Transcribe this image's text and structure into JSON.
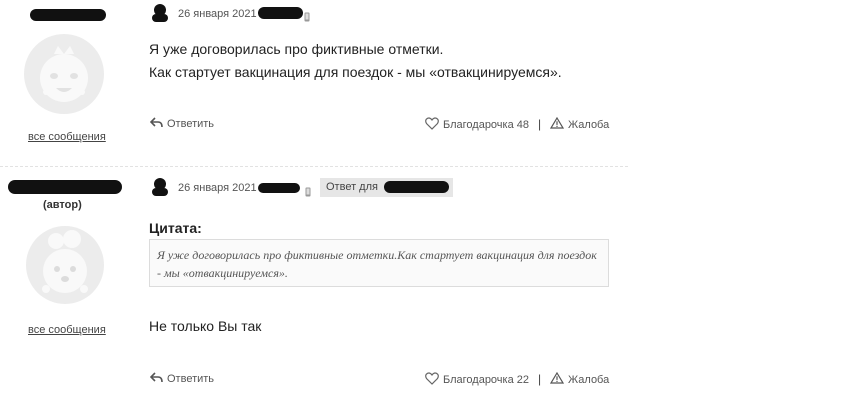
{
  "posts": [
    {
      "date": "26 января 2021",
      "message_lines": [
        "Я уже договорилась про фиктивные отметки.",
        "Как стартует вакцинация для поездок - мы «отвакцинируемся»."
      ],
      "all_messages_label": "все сообщения",
      "reply_label": "Ответить",
      "thanks_label": "Благодарочка 48",
      "separator": "|",
      "complaint_label": "Жалоба"
    },
    {
      "author_tag": "(автор)",
      "date": "26 января 2021",
      "reply_to_label": "Ответ для",
      "quote_label": "Цитата:",
      "quote_text": "Я уже договорилась про фиктивные отметки.Как стартует вакцинация для поездок - мы «отвакцинируемся».",
      "message": "Не только Вы так",
      "all_messages_label": "все сообщения",
      "reply_label": "Ответить",
      "thanks_label": "Благодарочка 22",
      "separator": "|",
      "complaint_label": "Жалоба"
    }
  ],
  "icons": {
    "reply": "reply-arrow-icon",
    "thanks": "heart-icon",
    "complaint": "warning-triangle-icon",
    "device": "phone-icon",
    "user_small": "user-small-icon"
  },
  "colors": {
    "redaction": "#111111",
    "avatar": "#e9e9e9",
    "reply_tag_bg": "#e6e6e6"
  }
}
